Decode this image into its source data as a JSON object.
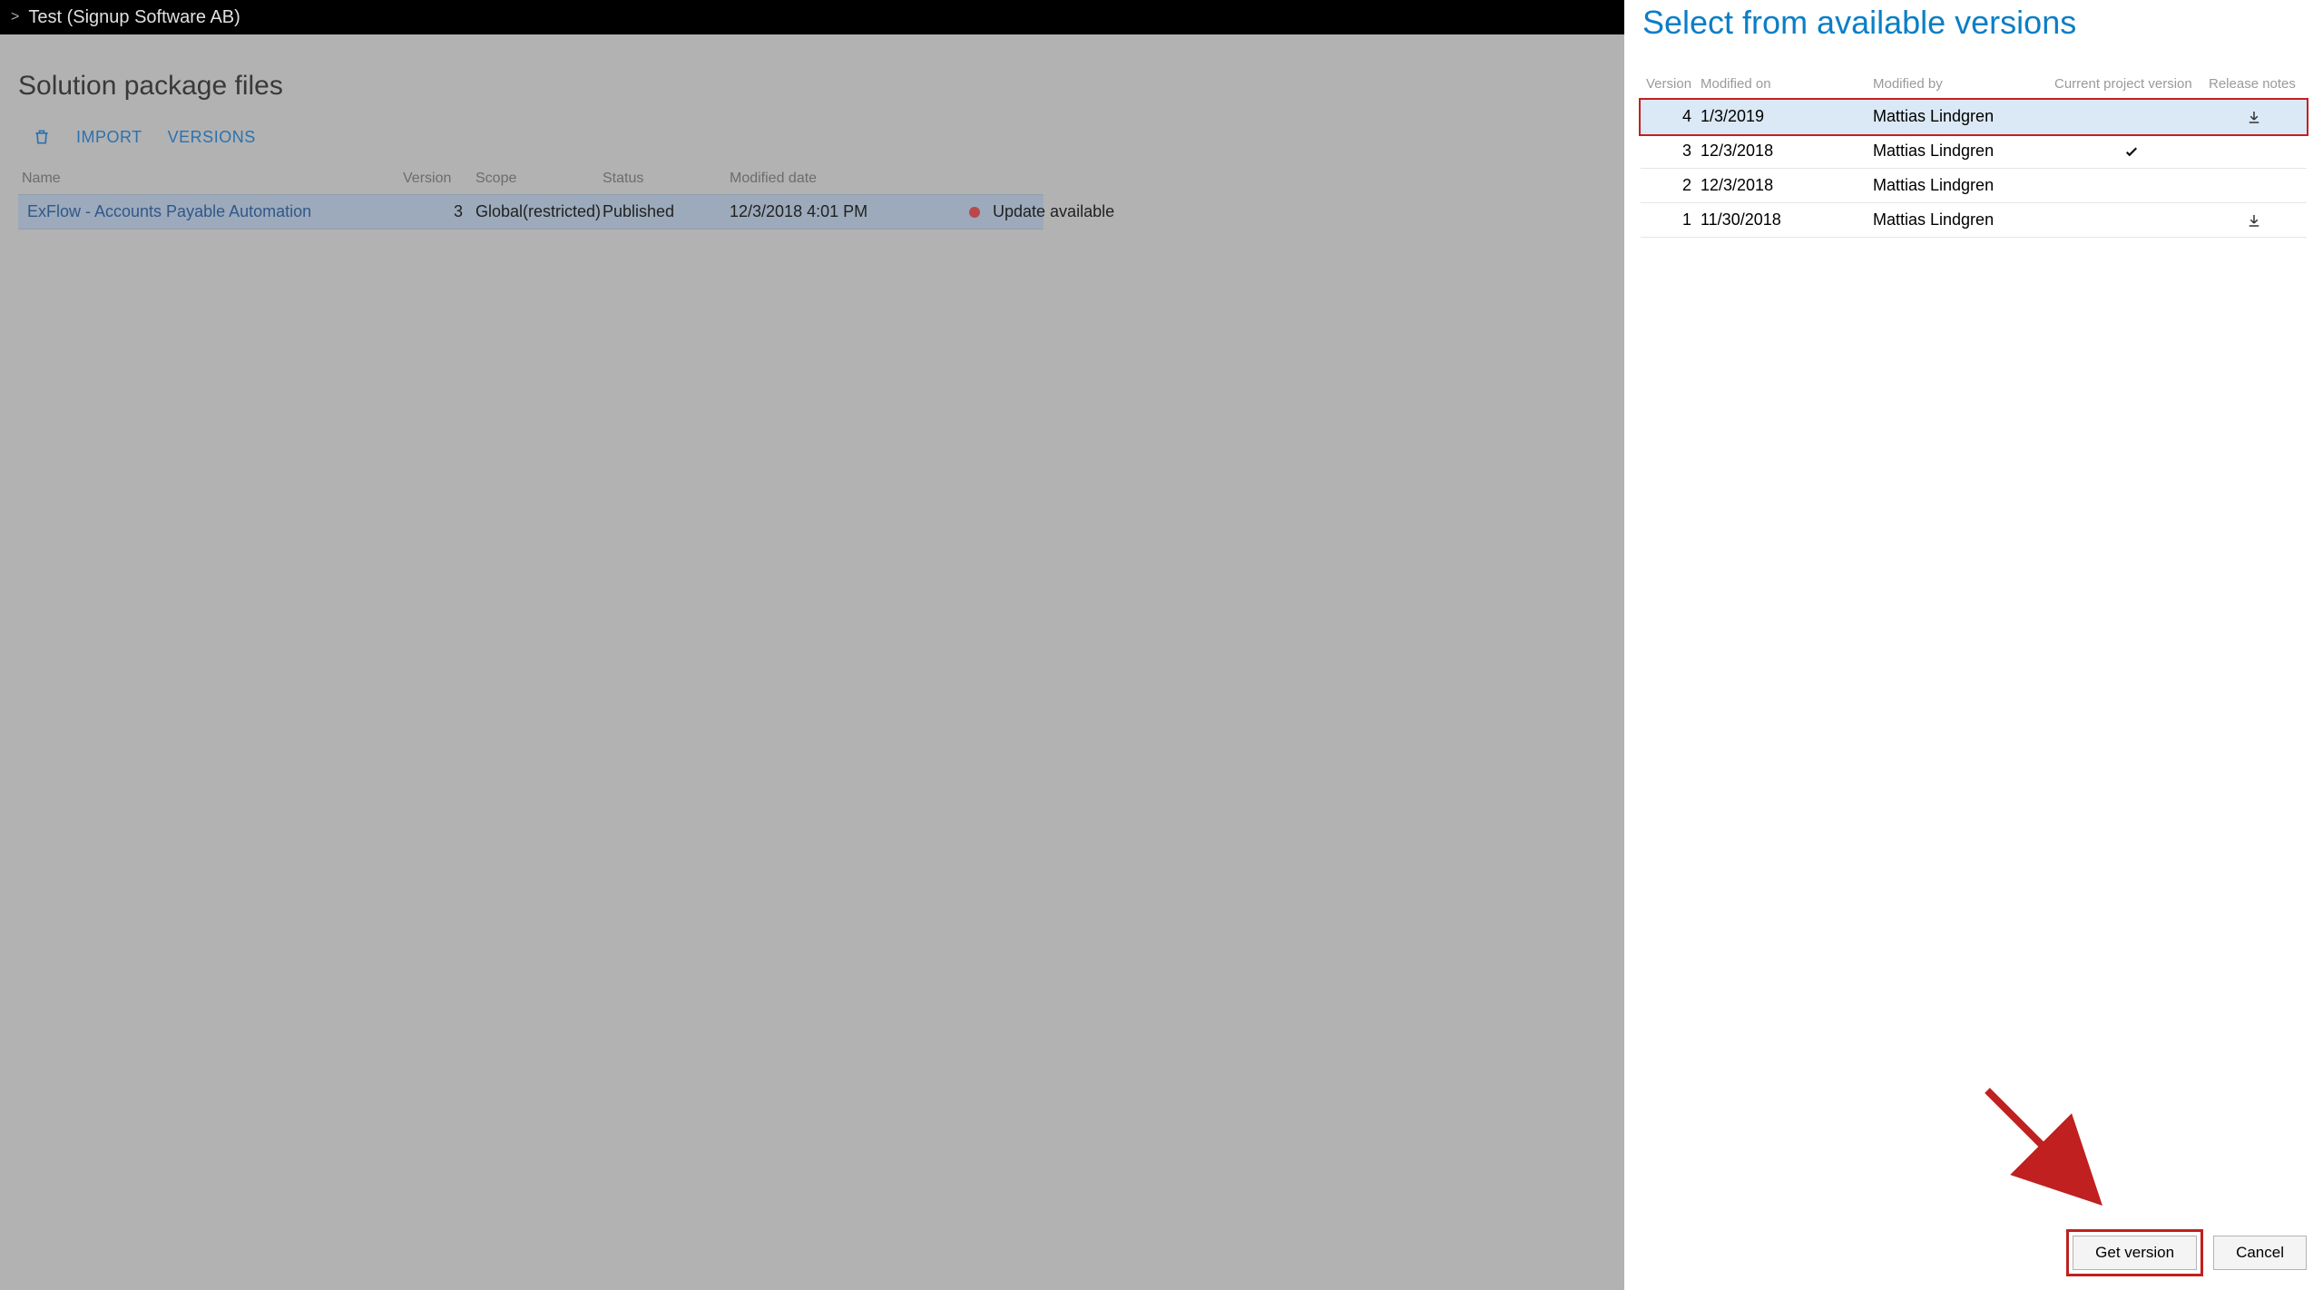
{
  "titlebar": {
    "breadcrumb": "Test (Signup Software AB)"
  },
  "page": {
    "heading": "Solution package files",
    "toolbar": {
      "import": "IMPORT",
      "versions": "VERSIONS"
    },
    "columns": {
      "name": "Name",
      "version": "Version",
      "scope": "Scope",
      "status": "Status",
      "modified": "Modified date"
    },
    "row": {
      "name": "ExFlow - Accounts Payable Automation",
      "version": "3",
      "scope": "Global(restricted)",
      "status": "Published",
      "modified": "12/3/2018 4:01 PM",
      "update_flag": "Update available"
    }
  },
  "panel": {
    "title": "Select from available versions",
    "columns": {
      "version": "Version",
      "modified_on": "Modified on",
      "modified_by": "Modified by",
      "current": "Current project version",
      "notes": "Release notes"
    },
    "rows": [
      {
        "version": "4",
        "modified_on": "1/3/2019",
        "modified_by": "Mattias Lindgren",
        "current": false,
        "notes": true,
        "selected": true,
        "highlight": true
      },
      {
        "version": "3",
        "modified_on": "12/3/2018",
        "modified_by": "Mattias Lindgren",
        "current": true,
        "notes": false,
        "selected": false,
        "highlight": false
      },
      {
        "version": "2",
        "modified_on": "12/3/2018",
        "modified_by": "Mattias Lindgren",
        "current": false,
        "notes": false,
        "selected": false,
        "highlight": false
      },
      {
        "version": "1",
        "modified_on": "11/30/2018",
        "modified_by": "Mattias Lindgren",
        "current": false,
        "notes": true,
        "selected": false,
        "highlight": false
      }
    ],
    "buttons": {
      "primary": "Get version",
      "cancel": "Cancel"
    }
  }
}
